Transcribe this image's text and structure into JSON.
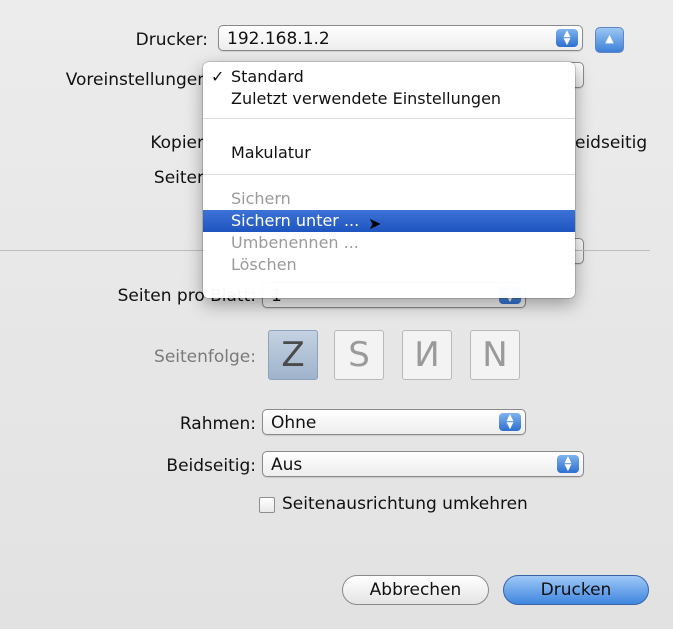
{
  "printer": {
    "label": "Drucker:",
    "value": "192.168.1.2"
  },
  "presets": {
    "label": "Voreinstellungen"
  },
  "background_labels": {
    "copies": "Kopier",
    "pages": "Seiter",
    "duplex_right": "eidseitig"
  },
  "preset_menu": {
    "items": [
      {
        "label": "Standard",
        "checked": true,
        "disabled": false
      },
      {
        "label": "Zuletzt verwendete Einstellungen",
        "disabled": false
      },
      {
        "label": "Makulatur",
        "disabled": false
      },
      {
        "label": "Sichern",
        "disabled": true
      },
      {
        "label": "Sichern unter ...",
        "selected": true,
        "disabled": false
      },
      {
        "label": "Umbenennen ...",
        "disabled": true
      },
      {
        "label": "Löschen",
        "disabled": true
      }
    ]
  },
  "layout": {
    "pages_per_sheet": {
      "label": "Seiten pro Blatt:",
      "value": "1"
    },
    "page_order": {
      "label": "Seitenfolge:"
    },
    "border": {
      "label": "Rahmen:",
      "value": "Ohne"
    },
    "duplex": {
      "label": "Beidseitig:",
      "value": "Aus"
    },
    "reverse_orientation": {
      "label": "Seitenausrichtung umkehren",
      "checked": false
    }
  },
  "buttons": {
    "cancel": "Abbrechen",
    "print": "Drucken"
  },
  "icons": {
    "popup_arrows": "up-down-arrows-icon",
    "disclosure": "disclosure-triangle-icon",
    "checkmark": "checkmark-icon",
    "cursor": "mouse-pointer-icon"
  },
  "colors": {
    "accent": "#2e6fd0",
    "menu_highlight": "#1d54bf"
  }
}
